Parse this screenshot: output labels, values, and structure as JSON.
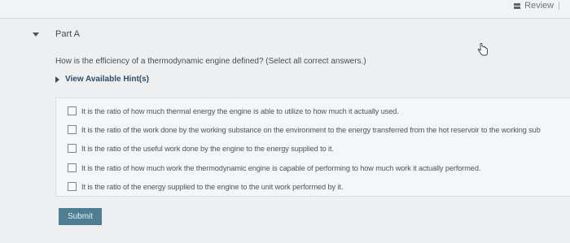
{
  "header": {
    "review_label": "Review",
    "separator": "|"
  },
  "part": {
    "title": "Part A"
  },
  "question": {
    "text": "How is the efficiency of a thermodynamic engine defined? (Select all correct answers.)"
  },
  "hints": {
    "label": "View Available Hint(s)"
  },
  "options": [
    {
      "label": "It is the ratio of how much thermal energy the engine is able to utilize to how much it actually used.",
      "checked": false
    },
    {
      "label": "It is the ratio of the work done by the working substance on the environment to the energy transferred from the hot reservoir to the working sub",
      "checked": false
    },
    {
      "label": "It is the ratio of the useful work done by the engine to the energy supplied to it.",
      "checked": false
    },
    {
      "label": "It is the ratio of how much work the thermodynamic engine is capable of performing to how much work it actually performed.",
      "checked": false
    },
    {
      "label": "It is the ratio of the energy supplied to the engine to the unit work performed by it.",
      "checked": false
    }
  ],
  "submit": {
    "label": "Submit"
  },
  "colors": {
    "submit_bg": "#4f7d91",
    "hint_link": "#2f4d68",
    "page_bg": "#eeeff0"
  },
  "icons": {
    "review": "review-icon",
    "part_toggle": "caret-down-icon",
    "hint_toggle": "caret-right-icon",
    "pointer": "hand-cursor-icon"
  }
}
